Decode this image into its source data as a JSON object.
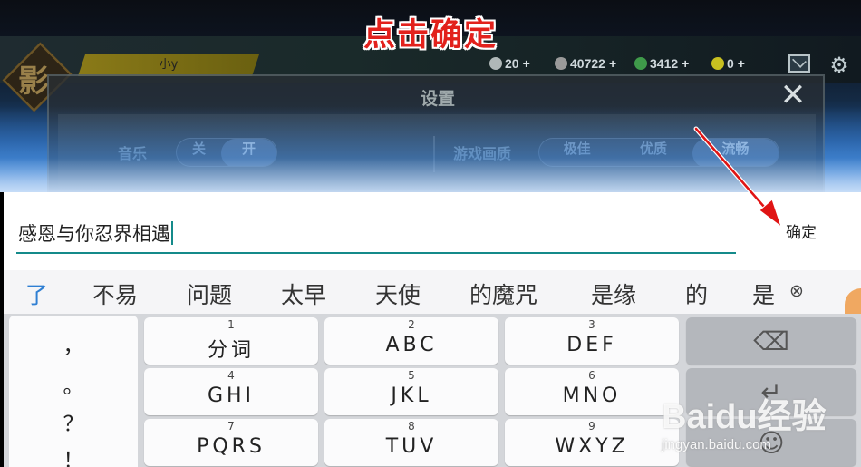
{
  "annotation": {
    "title": "点击确定",
    "title_color": "#e2211c",
    "arrow_color": "#e01414"
  },
  "game_background": {
    "emblem_glyph": "影",
    "name_plate_text": "小y",
    "resources": [
      {
        "text": "20",
        "dot_color": "#b0b8b8"
      },
      {
        "text": "40722",
        "dot_color": "#9a9a9a"
      },
      {
        "text": "3412",
        "dot_color": "#3f9a4a"
      },
      {
        "text": "0",
        "dot_color": "#c8c020"
      }
    ],
    "dialog_title": "设置",
    "options": [
      {
        "label": "音乐",
        "choices": [
          "关",
          "开"
        ],
        "selected": "开"
      },
      {
        "label": "游戏画质",
        "choices": [
          "极佳",
          "优质",
          "流畅"
        ],
        "selected": "流畅"
      }
    ]
  },
  "input": {
    "value": "感恩与你忍界相遇",
    "confirm_label": "确定",
    "underline_color": "#148a8a"
  },
  "candidates": [
    "了",
    "不易",
    "问题",
    "太早",
    "天使",
    "的魔咒",
    "是缘",
    "的",
    "是"
  ],
  "candidate_close_symbol": "⊗",
  "keyboard": {
    "punctuation": [
      "，",
      "。",
      "？",
      "！"
    ],
    "rows": [
      [
        {
          "num": "1",
          "label": "分词"
        },
        {
          "num": "2",
          "label": "ABC"
        },
        {
          "num": "3",
          "label": "DEF"
        }
      ],
      [
        {
          "num": "4",
          "label": "GHI"
        },
        {
          "num": "5",
          "label": "JKL"
        },
        {
          "num": "6",
          "label": "MNO"
        }
      ],
      [
        {
          "num": "7",
          "label": "PQRS"
        },
        {
          "num": "8",
          "label": "TUV"
        },
        {
          "num": "9",
          "label": "WXYZ"
        }
      ]
    ],
    "function_keys": [
      {
        "name": "backspace-key",
        "icon": "⌫"
      },
      {
        "name": "enter-key",
        "icon": "↵"
      },
      {
        "name": "emoji-key",
        "icon": "☺"
      }
    ]
  },
  "watermark": {
    "brand": "Baidu经验",
    "url": "jingyan.baidu.com"
  }
}
